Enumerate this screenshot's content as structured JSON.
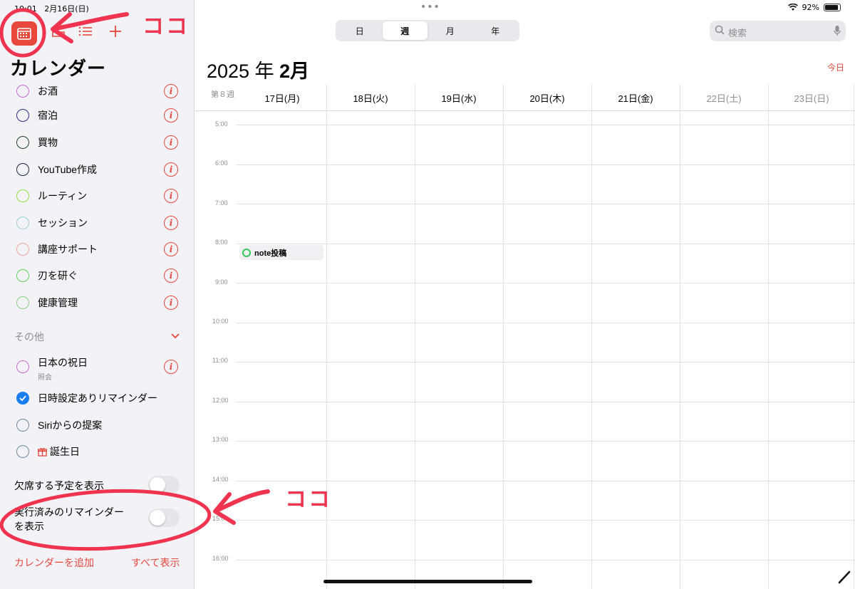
{
  "status": {
    "time": "10:01",
    "date": "2月16日(日)",
    "battery": "92%",
    "battery_level": 0.92
  },
  "sidebar": {
    "title": "カレンダー",
    "calendars": [
      {
        "name": "お酒",
        "color": "#c86ad6"
      },
      {
        "name": "宿泊",
        "color": "#2c2f8a"
      },
      {
        "name": "買物",
        "color": "#1f4a24"
      },
      {
        "name": "YouTube作成",
        "color": "#1c2a44"
      },
      {
        "name": "ルーティン",
        "color": "#8fe04a"
      },
      {
        "name": "セッション",
        "color": "#9fd3df"
      },
      {
        "name": "講座サポート",
        "color": "#f0a79c"
      },
      {
        "name": "刃を研ぐ",
        "color": "#5fd35a"
      },
      {
        "name": "健康管理",
        "color": "#8ad07a"
      }
    ],
    "other_section": "その他",
    "other": [
      {
        "name": "日本の祝日",
        "sub": "照会",
        "color": "#c86ad6"
      },
      {
        "name": "日時設定ありリマインダー",
        "color": "#1a7ef2",
        "checked": true
      },
      {
        "name": "Siriからの提案",
        "color": "#6e8aa0"
      },
      {
        "name": "誕生日",
        "color": "#6e8aa0"
      }
    ],
    "toggle_declined": "欠席する予定を表示",
    "toggle_completed_line1": "実行済みのリマインダー",
    "toggle_completed_line2": "を表示",
    "add_calendar": "カレンダーを追加",
    "show_all": "すべて表示"
  },
  "main": {
    "segments": [
      "日",
      "週",
      "月",
      "年"
    ],
    "active_segment": "週",
    "search_placeholder": "検索",
    "year": "2025",
    "year_suffix": "年",
    "month": "2月",
    "today": "今日",
    "week_label": "第８週",
    "days": [
      "17日(月)",
      "18日(火)",
      "19日(水)",
      "20日(木)",
      "21日(金)",
      "22日(土)",
      "23日(日)"
    ],
    "hours": [
      "5:00",
      "6:00",
      "7:00",
      "8:00",
      "9:00",
      "10:00",
      "11:00",
      "12:00",
      "13:00",
      "14:00",
      "15:00",
      "16:00"
    ],
    "event": {
      "title": "note投稿",
      "day": "17日(月)",
      "time": "8:00"
    }
  },
  "annotations": {
    "label": "ココ"
  },
  "colors": {
    "accent": "#e8473c",
    "annotation": "#f0334e",
    "check": "#1a7ef2"
  }
}
